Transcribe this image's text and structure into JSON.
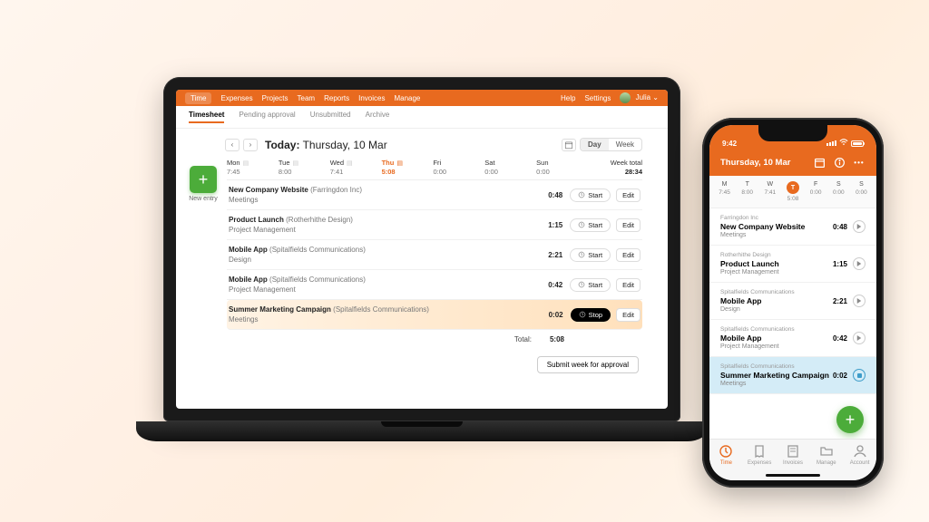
{
  "colors": {
    "accent": "#e86a1f",
    "positive": "#4cac3a"
  },
  "laptop": {
    "nav": {
      "items": [
        "Time",
        "Expenses",
        "Projects",
        "Team",
        "Reports",
        "Invoices",
        "Manage"
      ],
      "active": 0,
      "help": "Help",
      "settings": "Settings",
      "user": "Julia"
    },
    "subnav": {
      "items": [
        "Timesheet",
        "Pending approval",
        "Unsubmitted",
        "Archive"
      ],
      "active": 0
    },
    "date": {
      "label_prefix": "Today:",
      "label_rest": " Thursday, 10 Mar",
      "view_day": "Day",
      "view_week": "Week"
    },
    "new_entry_label": "New entry",
    "week": {
      "days": [
        {
          "name": "Mon",
          "time": "7:45"
        },
        {
          "name": "Tue",
          "time": "8:00"
        },
        {
          "name": "Wed",
          "time": "7:41"
        },
        {
          "name": "Thu",
          "time": "5:08",
          "active": true
        },
        {
          "name": "Fri",
          "time": "0:00"
        },
        {
          "name": "Sat",
          "time": "0:00"
        },
        {
          "name": "Sun",
          "time": "0:00"
        }
      ],
      "total_label": "Week total",
      "total_value": "28:34"
    },
    "entries": [
      {
        "title": "New Company Website",
        "client": "(Farringdon Inc)",
        "sub": "Meetings",
        "dur": "0:48",
        "action": "Start"
      },
      {
        "title": "Product Launch",
        "client": "(Rotherhithe Design)",
        "sub": "Project Management",
        "dur": "1:15",
        "action": "Start"
      },
      {
        "title": "Mobile App",
        "client": "(Spitalfields Communications)",
        "sub": "Design",
        "dur": "2:21",
        "action": "Start"
      },
      {
        "title": "Mobile App",
        "client": "(Spitalfields Communications)",
        "sub": "Project Management",
        "dur": "0:42",
        "action": "Start"
      },
      {
        "title": "Summer Marketing Campaign",
        "client": "(Spitalfields Communications)",
        "sub": "Meetings",
        "dur": "0:02",
        "action": "Stop",
        "running": true
      }
    ],
    "edit_label": "Edit",
    "total_label": "Total:",
    "total_value": "5:08",
    "submit_label": "Submit week for approval"
  },
  "phone": {
    "status_time": "9:42",
    "header_title": "Thursday, 10 Mar",
    "week": {
      "days": [
        {
          "l": "M",
          "t": "7:45"
        },
        {
          "l": "T",
          "t": "8:00"
        },
        {
          "l": "W",
          "t": "7:41"
        },
        {
          "l": "T",
          "t": "5:08",
          "selected": true
        },
        {
          "l": "F",
          "t": "0:00"
        },
        {
          "l": "S",
          "t": "0:00"
        },
        {
          "l": "S",
          "t": "0:00"
        }
      ]
    },
    "entries": [
      {
        "client": "Farringdon Inc",
        "title": "New Company Website",
        "sub": "Meetings",
        "dur": "0:48"
      },
      {
        "client": "Rotherhithe Design",
        "title": "Product Launch",
        "sub": "Project Management",
        "dur": "1:15"
      },
      {
        "client": "Spitalfields Communications",
        "title": "Mobile App",
        "sub": "Design",
        "dur": "2:21"
      },
      {
        "client": "Spitalfields Communications",
        "title": "Mobile App",
        "sub": "Project Management",
        "dur": "0:42"
      },
      {
        "client": "Spitalfields Communications",
        "title": "Summer Marketing Campaign",
        "sub": "Meetings",
        "dur": "0:02",
        "running": true
      }
    ],
    "tabs": [
      "Time",
      "Expenses",
      "Invoices",
      "Manage",
      "Account"
    ]
  }
}
